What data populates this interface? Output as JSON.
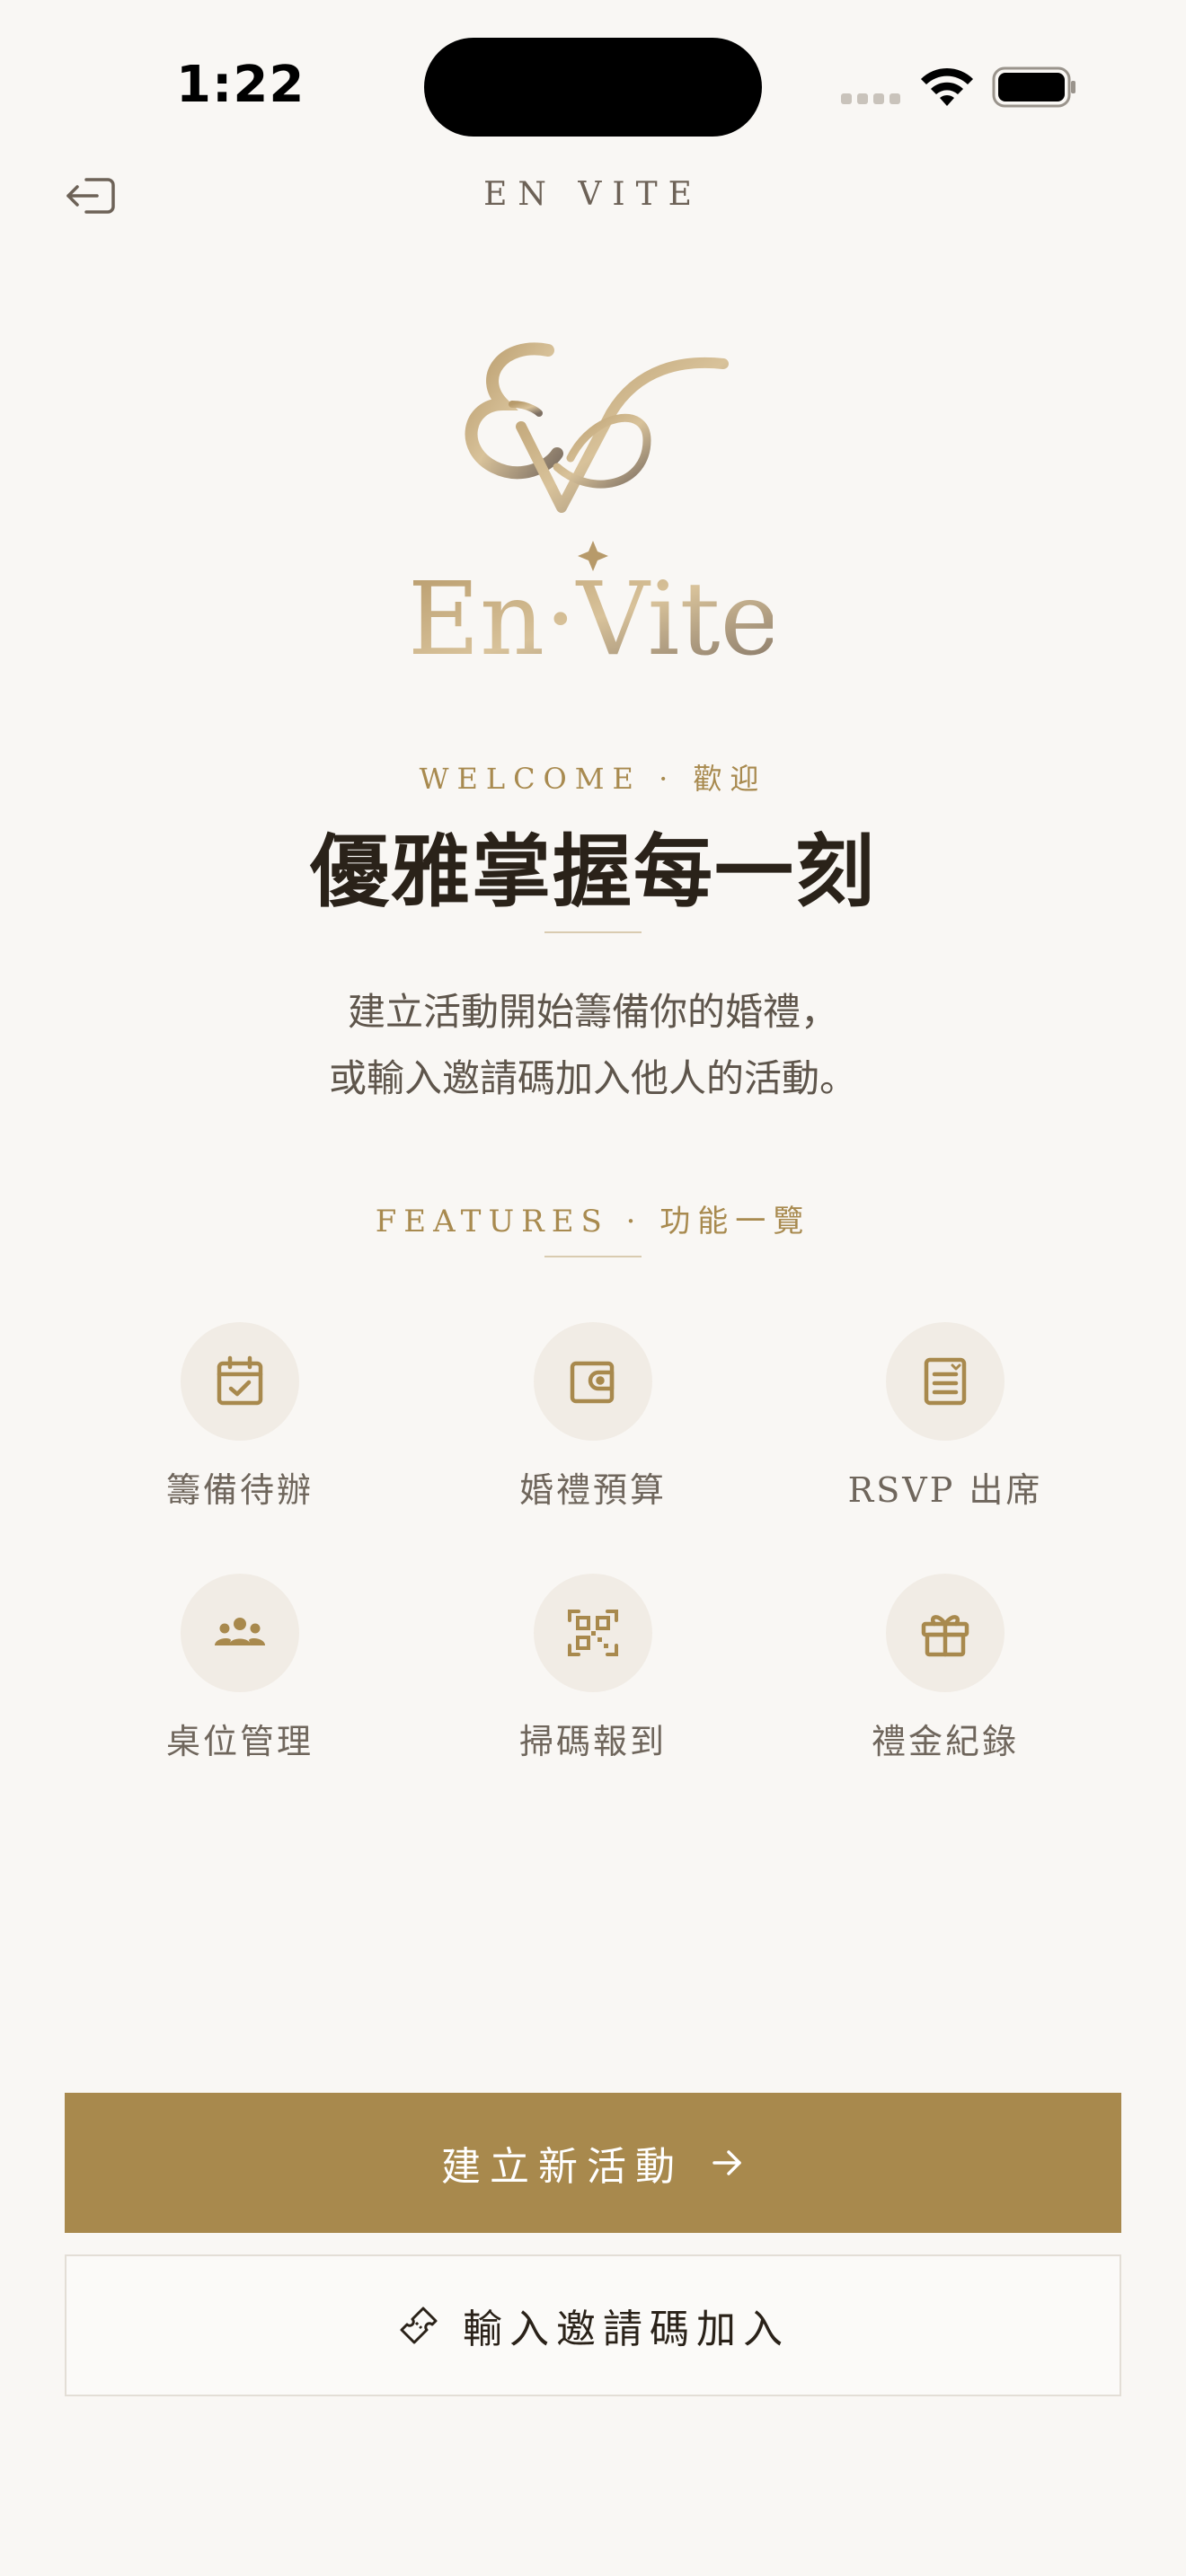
{
  "status_bar": {
    "time": "1:22"
  },
  "header": {
    "title": "EN VITE",
    "logout_icon": "logout-icon"
  },
  "logo": {
    "wordmark": "En·Vite",
    "monogram": "EV"
  },
  "welcome": {
    "kicker": "WELCOME · 歡迎",
    "headline": "優雅掌握每一刻",
    "description_line1": "建立活動開始籌備你的婚禮，",
    "description_line2": "或輸入邀請碼加入他人的活動。"
  },
  "features": {
    "kicker": "FEATURES · 功能一覽",
    "items": [
      {
        "label": "籌備待辦",
        "icon": "calendar-check-icon"
      },
      {
        "label": "婚禮預算",
        "icon": "wallet-icon"
      },
      {
        "label": "RSVP 出席",
        "icon": "list-icon"
      },
      {
        "label": "桌位管理",
        "icon": "group-icon"
      },
      {
        "label": "掃碼報到",
        "icon": "qr-code-icon"
      },
      {
        "label": "禮金紀錄",
        "icon": "gift-icon"
      }
    ]
  },
  "actions": {
    "create_label": "建立新活動",
    "join_label": "輸入邀請碼加入"
  },
  "colors": {
    "accent": "#a8894d",
    "background": "#f9f7f4",
    "icon_bg": "#f1ece5",
    "text_dark": "#2a2219"
  }
}
